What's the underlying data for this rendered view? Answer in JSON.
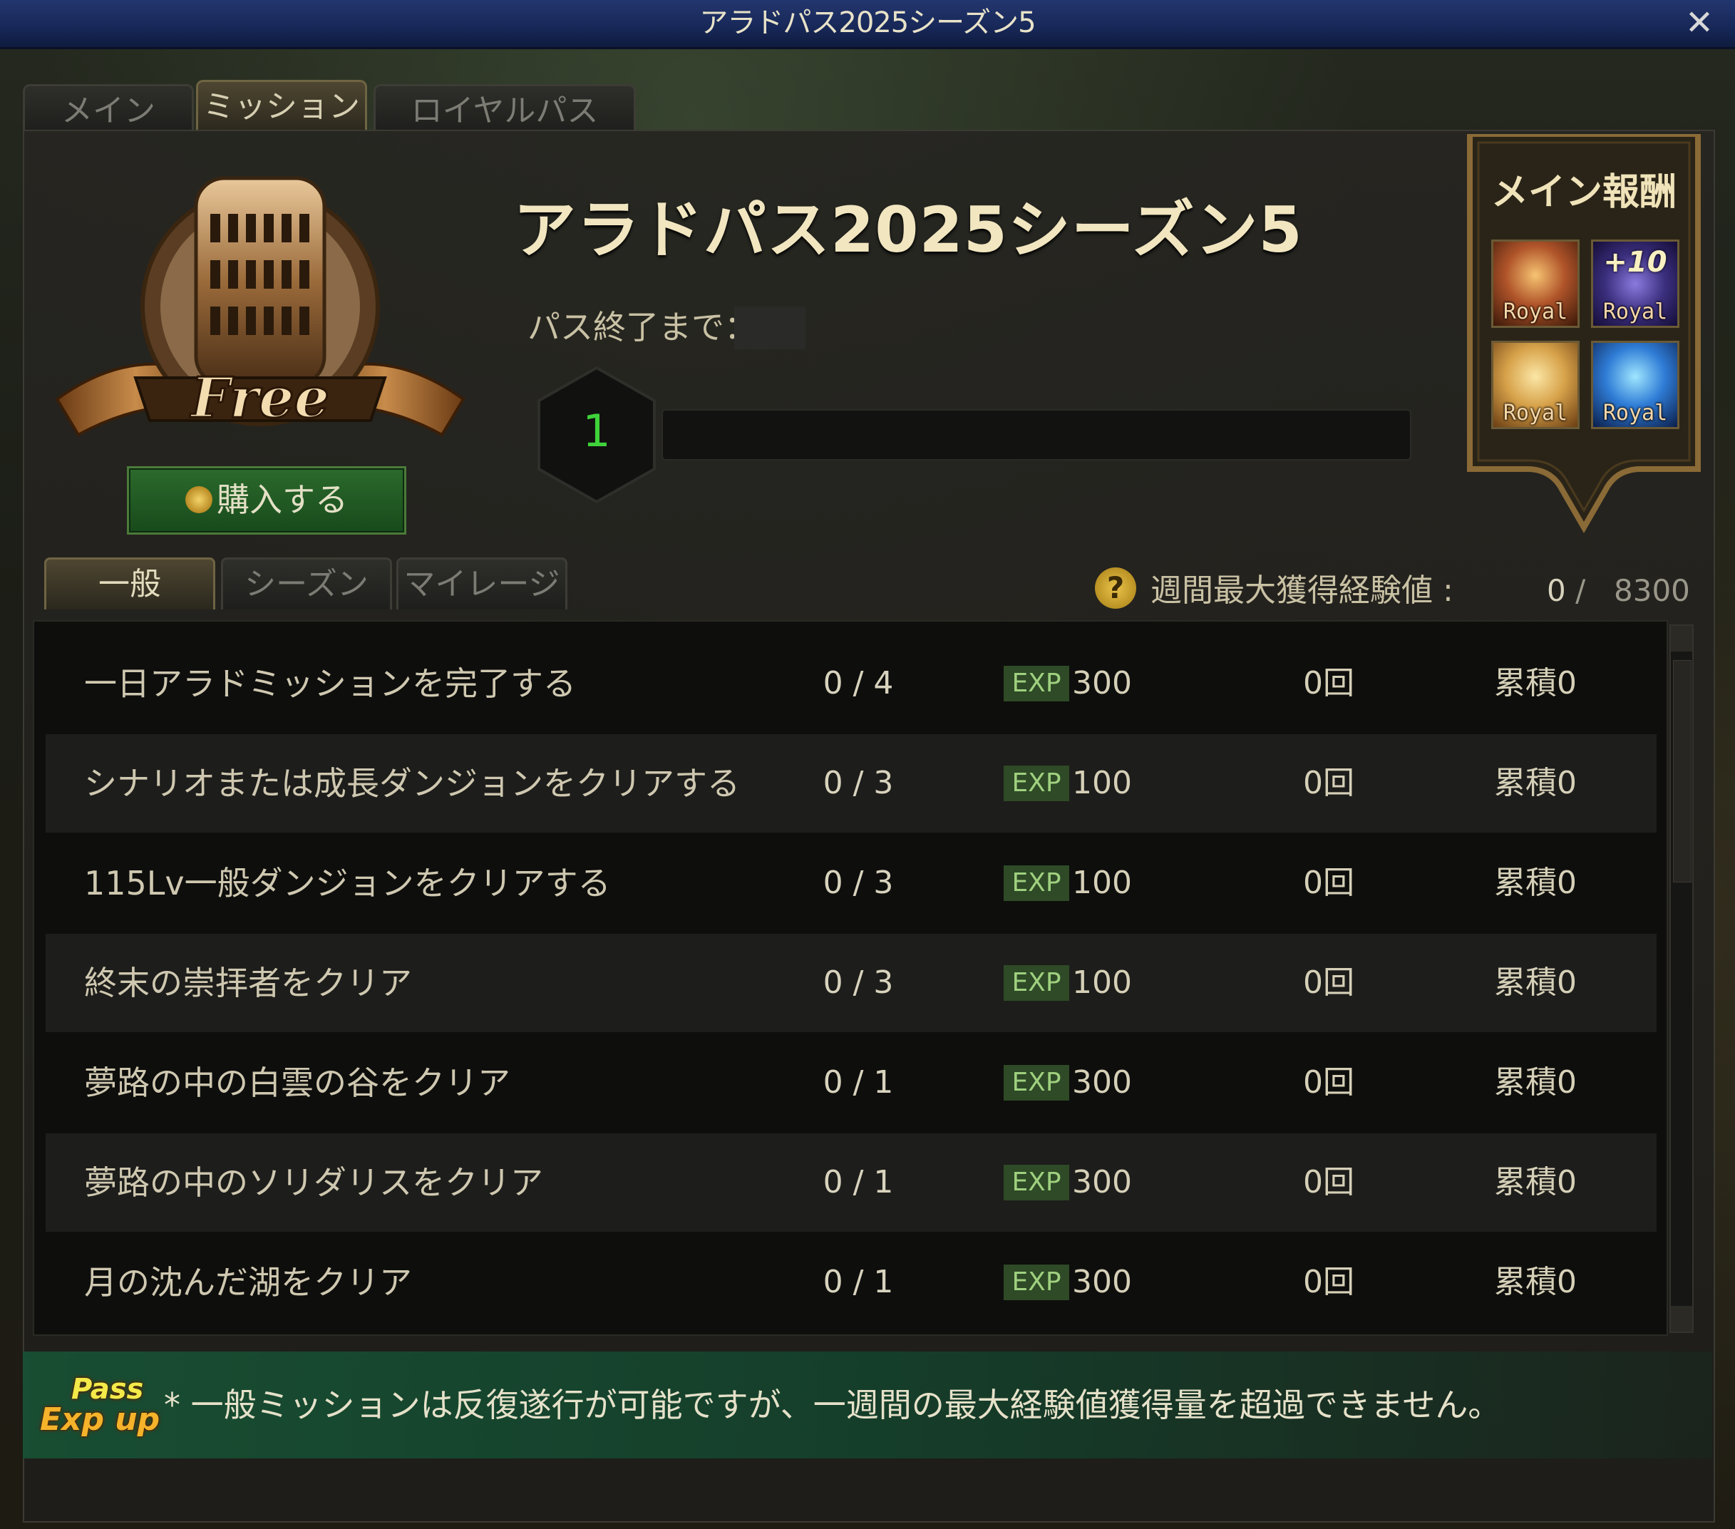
{
  "window": {
    "title": "アラドパス2025シーズン5",
    "close_label": "✕"
  },
  "top_tabs": [
    {
      "label": "メイン",
      "active": false
    },
    {
      "label": "ミッション",
      "active": true
    },
    {
      "label": "ロイヤルパス",
      "active": false
    }
  ],
  "emblem_text": "Free",
  "buy_button": {
    "label": "購入する"
  },
  "pass": {
    "title": "アラドパス2025シーズン5",
    "end_label": "パス終了まで：",
    "level": "1",
    "progress": 0
  },
  "main_reward": {
    "title": "メイン報酬",
    "items": [
      {
        "icon": "trophy-icon",
        "label": "Royal",
        "overlay": ""
      },
      {
        "icon": "upgrade-plus10-icon",
        "label": "Royal",
        "overlay": "+10"
      },
      {
        "icon": "scroll-box-icon",
        "label": "Royal",
        "overlay": ""
      },
      {
        "icon": "blue-armor-icon",
        "label": "Royal",
        "overlay": ""
      }
    ]
  },
  "sub_tabs": [
    {
      "label": "一般",
      "active": true
    },
    {
      "label": "シーズン",
      "active": false
    },
    {
      "label": "マイレージ",
      "active": false
    }
  ],
  "weekly": {
    "help": "?",
    "label": "週間最大獲得経験値 :",
    "current": "0",
    "separator": "/",
    "max": "8300"
  },
  "missions": [
    {
      "name": "一日アラドミッションを完了する",
      "progress": "0 / 4",
      "exp_tag": "EXP",
      "exp": "300",
      "count": "0回",
      "accum": "累積0"
    },
    {
      "name": "シナリオまたは成長ダンジョンをクリアする",
      "progress": "0 / 3",
      "exp_tag": "EXP",
      "exp": "100",
      "count": "0回",
      "accum": "累積0"
    },
    {
      "name": "115Lv一般ダンジョンをクリアする",
      "progress": "0 / 3",
      "exp_tag": "EXP",
      "exp": "100",
      "count": "0回",
      "accum": "累積0"
    },
    {
      "name": "終末の崇拝者をクリア",
      "progress": "0 / 3",
      "exp_tag": "EXP",
      "exp": "100",
      "count": "0回",
      "accum": "累積0"
    },
    {
      "name": "夢路の中の白雲の谷をクリア",
      "progress": "0 / 1",
      "exp_tag": "EXP",
      "exp": "300",
      "count": "0回",
      "accum": "累積0"
    },
    {
      "name": "夢路の中のソリダリスをクリア",
      "progress": "0 / 1",
      "exp_tag": "EXP",
      "exp": "300",
      "count": "0回",
      "accum": "累積0"
    },
    {
      "name": "月の沈んだ湖をクリア",
      "progress": "0 / 1",
      "exp_tag": "EXP",
      "exp": "300",
      "count": "0回",
      "accum": "累積0"
    }
  ],
  "footer": {
    "badge_line1": "Pass",
    "badge_line2": "Exp up",
    "note": "* 一般ミッションは反復遂行が可能ですが、一週間の最大経験値獲得量を超過できません。"
  },
  "colors": {
    "accent_gold": "#e9c34a",
    "level_green": "#3fd23a",
    "buy_green": "#2b6a2c",
    "title_blue": "#1d2f63"
  }
}
